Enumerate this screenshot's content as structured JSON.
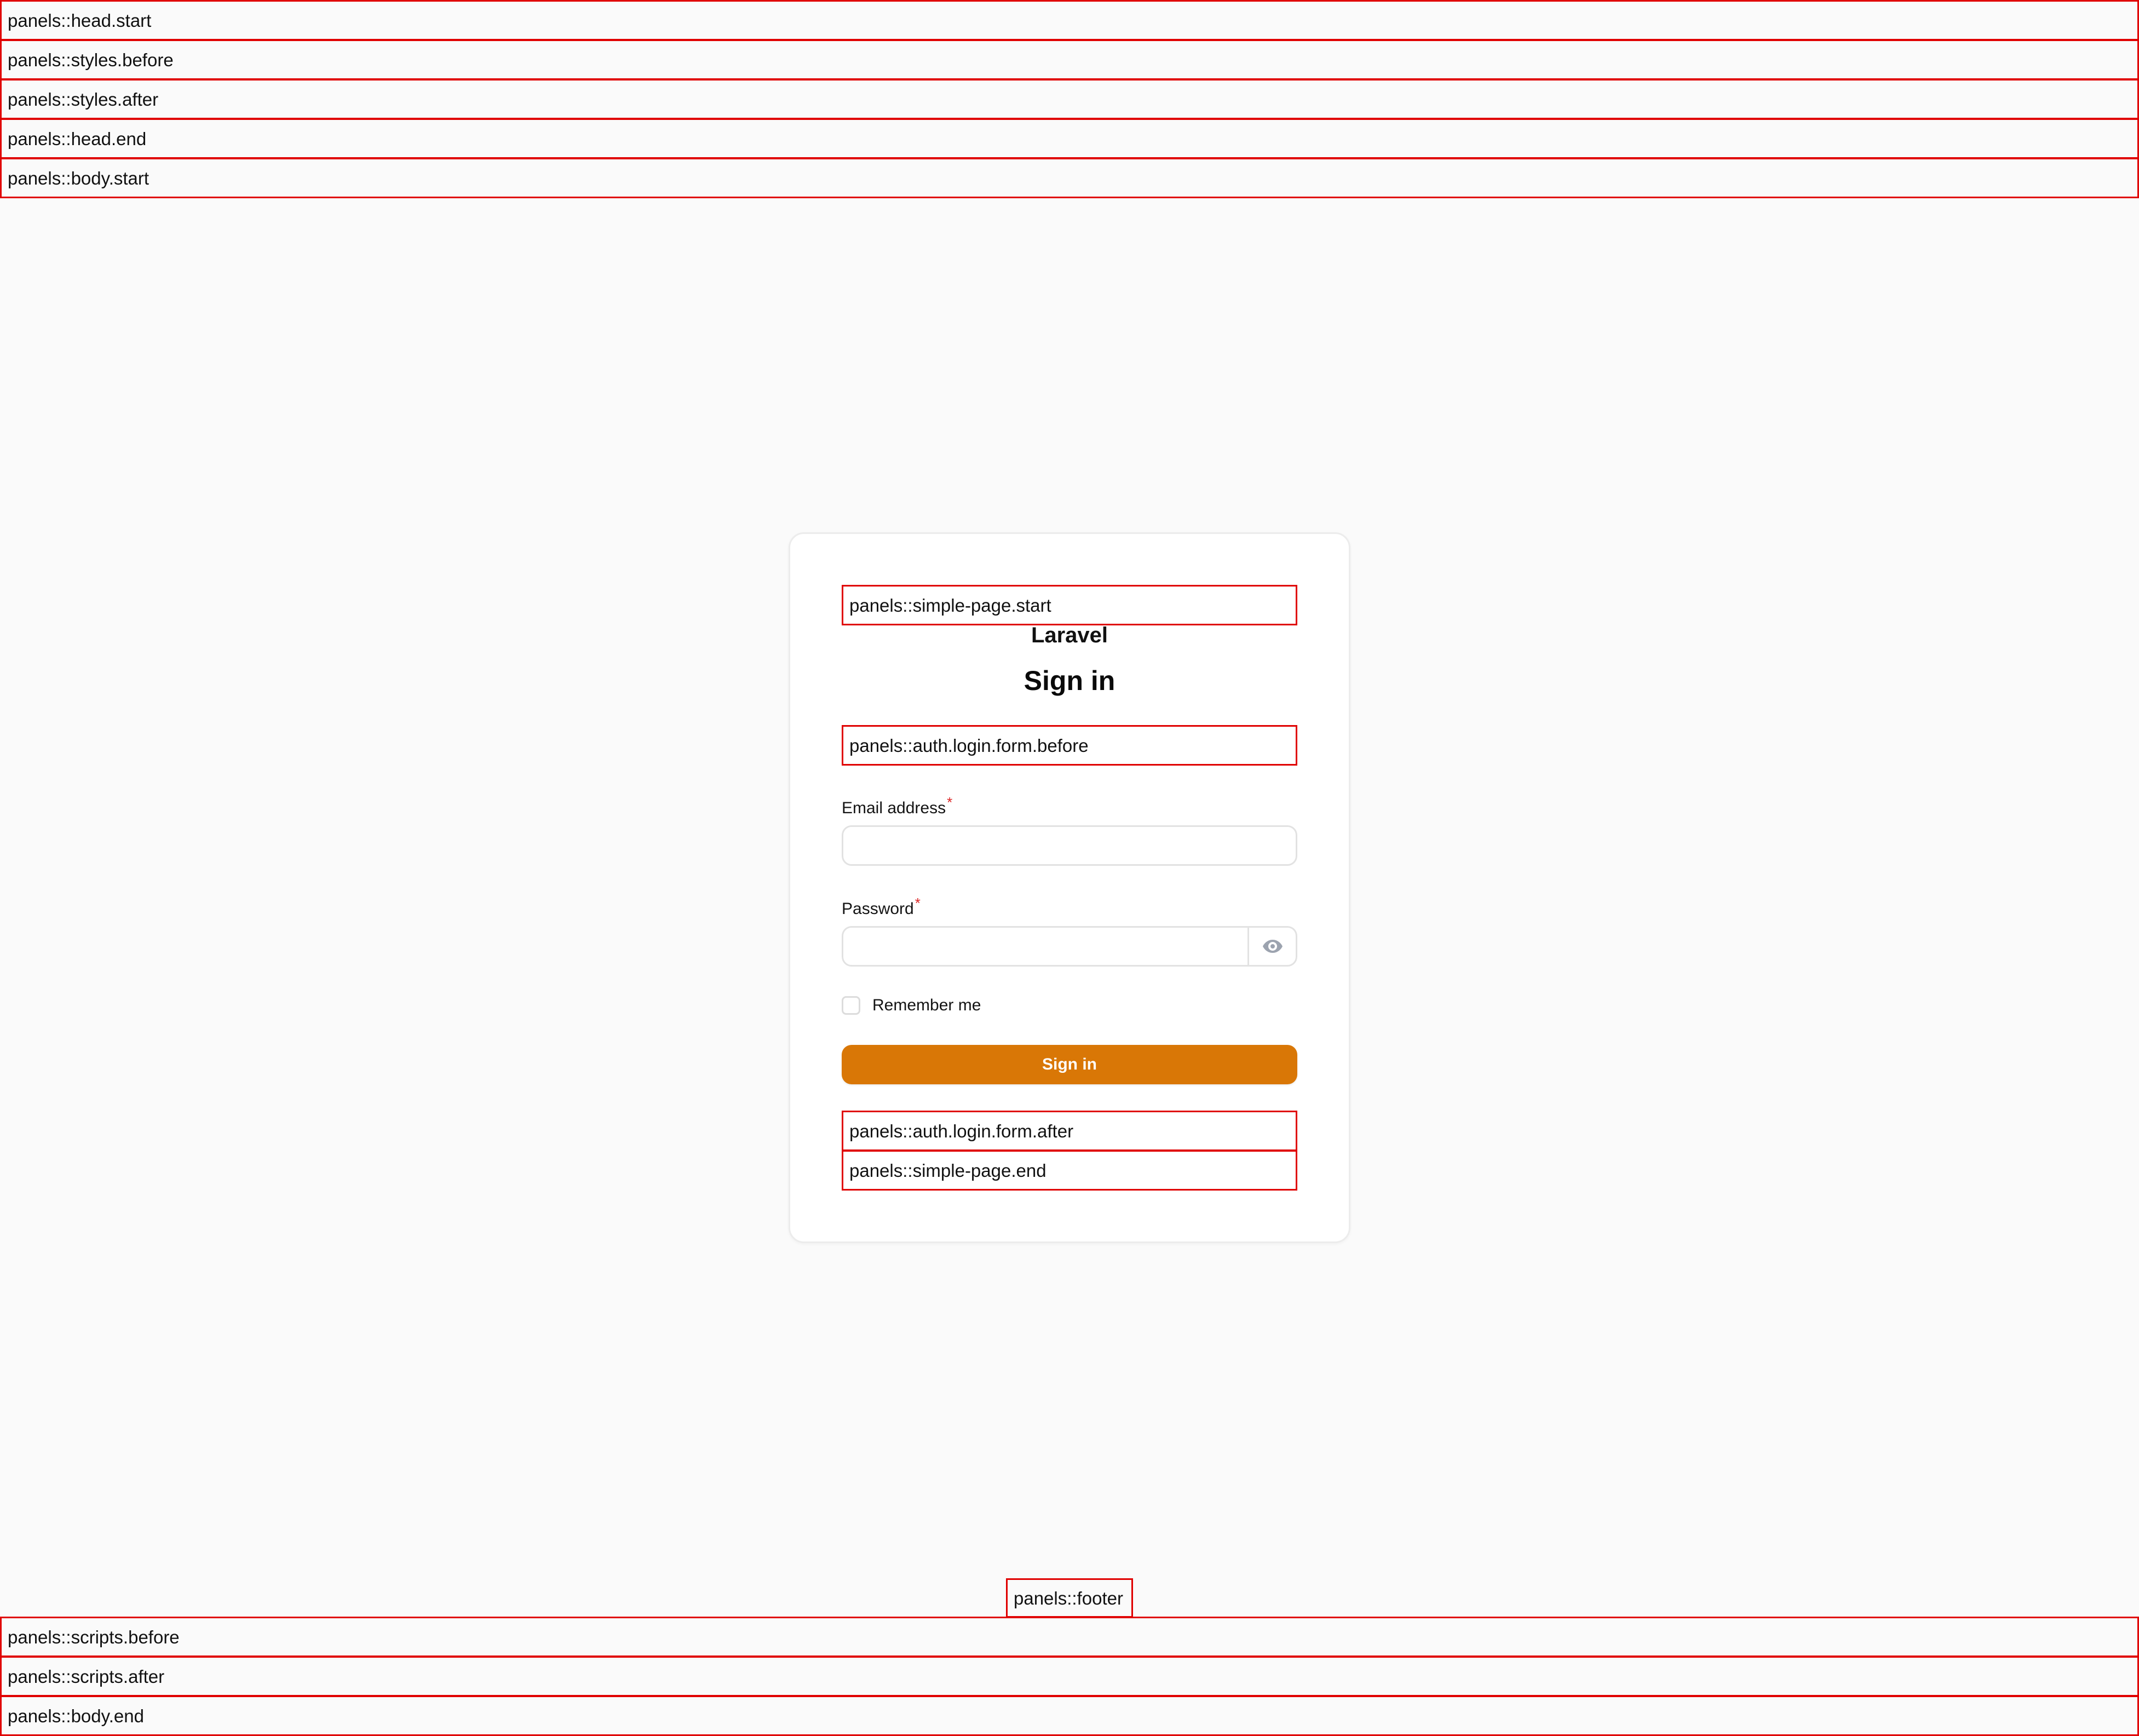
{
  "hooks": {
    "head_start": "panels::head.start",
    "styles_before": "panels::styles.before",
    "styles_after": "panels::styles.after",
    "head_end": "panels::head.end",
    "body_start": "panels::body.start",
    "simple_page_start": "panels::simple-page.start",
    "login_form_before": "panels::auth.login.form.before",
    "login_form_after": "panels::auth.login.form.after",
    "simple_page_end": "panels::simple-page.end",
    "footer": "panels::footer",
    "scripts_before": "panels::scripts.before",
    "scripts_after": "panels::scripts.after",
    "body_end": "panels::body.end"
  },
  "brand": "Laravel",
  "heading": "Sign in",
  "form": {
    "email": {
      "label": "Email address",
      "required_mark": "*",
      "value": ""
    },
    "password": {
      "label": "Password",
      "required_mark": "*",
      "value": "",
      "reveal_icon": "eye-icon"
    },
    "remember": {
      "label": "Remember me",
      "checked": false
    },
    "submit_label": "Sign in"
  },
  "colors": {
    "accent": "#d97706",
    "hook_outline": "#e00000",
    "required": "#dc2626",
    "background": "#fafafa"
  }
}
